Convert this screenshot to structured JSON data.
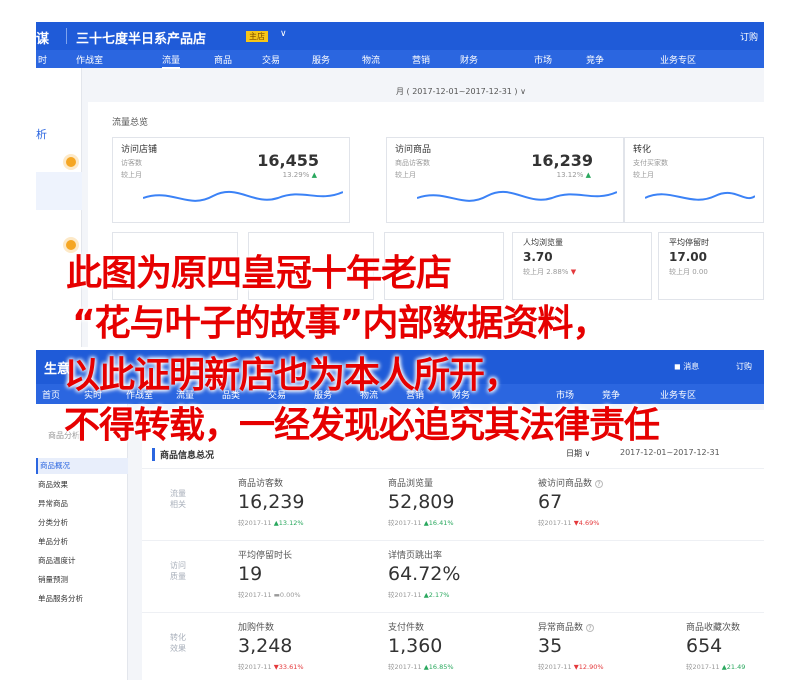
{
  "top": {
    "brand": "谋",
    "shop_name": "三十七度半日系产品店",
    "badge": "主店",
    "dropdown_icon": "chevron-down-icon",
    "top_right": "订购",
    "nav": [
      "时",
      "作战室",
      "流量",
      "商品",
      "交易",
      "服务",
      "物流",
      "营销",
      "财务",
      "市场",
      "竞争",
      "业务专区"
    ],
    "active_nav": "流量",
    "side_label": "析",
    "date_range": "月 ( 2017-12-01~2017-12-31 ) ∨",
    "section_title": "流量总览",
    "cards": [
      {
        "title": "访问店铺",
        "sub": "访客数",
        "compare": "较上月",
        "value": "16,455",
        "pct": "13.29%",
        "trend": "up"
      },
      {
        "title": "访问商品",
        "sub": "商品访客数",
        "compare": "较上月",
        "value": "16,239",
        "pct": "13.12%",
        "trend": "up"
      },
      {
        "title": "转化",
        "sub": "支付买家数",
        "compare": "较上月",
        "value": "",
        "pct": "",
        "trend": ""
      }
    ],
    "minis": [
      {
        "title": "人均浏览量",
        "value": "3.70",
        "pct": "较上月 2.88%",
        "trend": "down"
      },
      {
        "title": "平均停留时",
        "value": "17.00",
        "pct": "较上月 0.00",
        "trend": ""
      }
    ]
  },
  "bottom": {
    "brand": "生意",
    "message": "消息",
    "order": "订购",
    "nav": [
      "首页",
      "实时",
      "作战室",
      "流量",
      "品类",
      "交易",
      "服务",
      "物流",
      "营销",
      "财务",
      "市场",
      "竞争",
      "业务专区"
    ],
    "side_header": "商品分析",
    "side_items": [
      "商品概况",
      "商品效果",
      "异常商品",
      "分类分析",
      "单品分析",
      "商品温度计",
      "销量预测",
      "单品服务分析"
    ],
    "side_selected": 0,
    "content_title": "商品信息总况",
    "period_select": "日期",
    "date_range": "2017-12-01~2017-12-31",
    "groups": [
      "流量相关",
      "访问质量",
      "转化效果"
    ],
    "metrics": [
      {
        "label": "商品访客数",
        "value": "16,239",
        "compare": "较2017-11",
        "pct": "13.12%",
        "trend": "up",
        "help": false
      },
      {
        "label": "商品浏览量",
        "value": "52,809",
        "compare": "较2017-11",
        "pct": "16.41%",
        "trend": "up",
        "help": false
      },
      {
        "label": "被访问商品数",
        "value": "67",
        "compare": "较2017-11",
        "pct": "4.69%",
        "trend": "down",
        "help": true
      },
      {
        "label": "平均停留时长",
        "value": "19",
        "compare": "较2017-11",
        "pct": "0.00%",
        "trend": "flat",
        "help": false
      },
      {
        "label": "详情页跳出率",
        "value": "64.72%",
        "compare": "较2017-11",
        "pct": "2.17%",
        "trend": "up",
        "help": false
      },
      {
        "label": "加购件数",
        "value": "3,248",
        "compare": "较2017-11",
        "pct": "33.61%",
        "trend": "down",
        "help": false
      },
      {
        "label": "支付件数",
        "value": "1,360",
        "compare": "较2017-11",
        "pct": "16.85%",
        "trend": "up",
        "help": false
      },
      {
        "label": "异常商品数",
        "value": "35",
        "compare": "较2017-11",
        "pct": "12.90%",
        "trend": "down",
        "help": true
      },
      {
        "label": "商品收藏次数",
        "value": "654",
        "compare": "较2017-11",
        "pct": "21.49",
        "trend": "up",
        "help": false
      }
    ]
  },
  "watermark": [
    "此图为原四皇冠十年老店",
    "“花与叶子的故事”内部数据资料，",
    "以此证明新店也为本人所开，",
    "不得转载，一经发现必追究其法律责任"
  ],
  "colors": {
    "header_blue": "#1f5bd8",
    "nav_blue": "#2b66e0",
    "up_green": "#2aa85e",
    "down_red": "#e4393c",
    "watermark_red": "#e60000",
    "badge_yellow": "#f5c518"
  }
}
